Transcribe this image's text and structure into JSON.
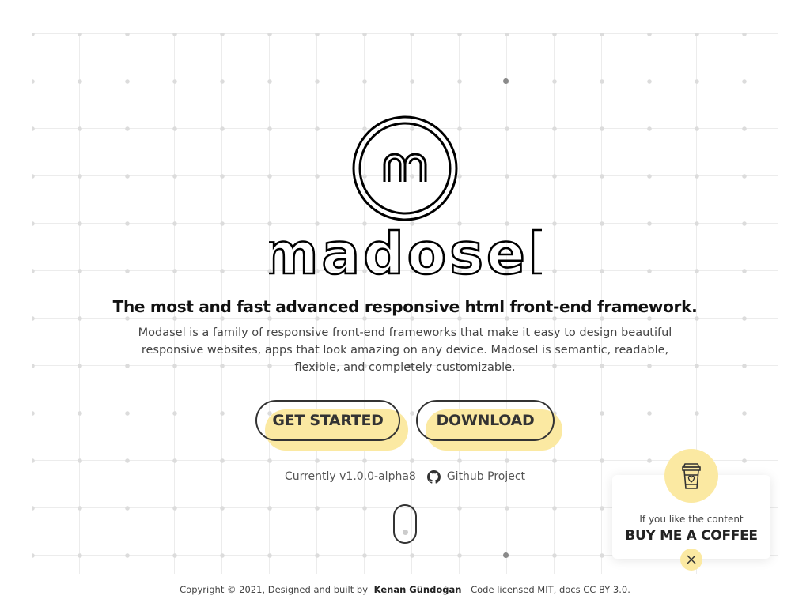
{
  "brand": {
    "wordmark": "madosel",
    "logo_letter": "m"
  },
  "hero": {
    "headline": "The most and fast advanced responsive html front-end framework.",
    "description": "Modasel is a family of responsive front-end frameworks that make it easy to design beautiful responsive websites, apps that look amazing on any device. Madosel is semantic, readable, flexible, and completely customizable."
  },
  "buttons": {
    "get_started": "GET STARTED",
    "download": "DOWNLOAD"
  },
  "meta": {
    "version": "Currently v1.0.0-alpha8",
    "github": "Github Project"
  },
  "footer": {
    "prefix": "Copyright © 2021, Designed and built by",
    "author": "Kenan Gündoğan",
    "license": "Code licensed MIT, docs CC BY 3.0."
  },
  "coffee": {
    "small": "If you like the content",
    "big": "BUY ME A COFFEE"
  },
  "colors": {
    "accent": "#fbe9a2",
    "text": "#333333",
    "grid": "#ececec"
  },
  "icons": [
    "github-icon",
    "coffee-cup-icon",
    "close-icon",
    "mouse-scroll-icon"
  ]
}
